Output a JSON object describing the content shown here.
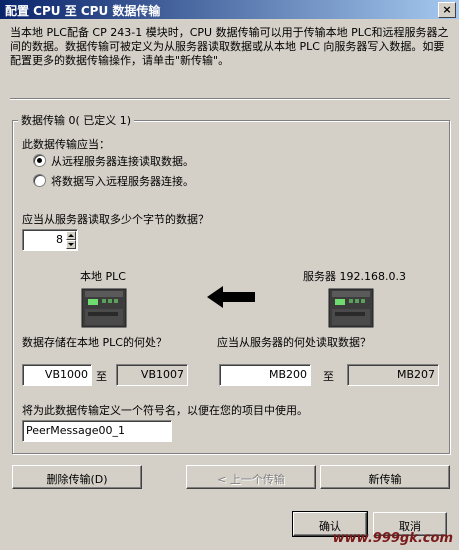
{
  "window": {
    "title": "配置 CPU 至 CPU 数据传输",
    "close_glyph": "×"
  },
  "description": "当本地 PLC配备 CP 243-1 模块时，CPU 数据传输可以用于传输本地 PLC和远程服务器之间的数据。数据传输可被定义为从服务器读取数据或从本地 PLC 向服务器写入数据。如要配置更多的数据传输操作，请单击\"新传输\"。",
  "group_title": "数据传输 0( 已定义 1)",
  "direction": {
    "label": "此数据传输应当：",
    "options": [
      {
        "label": "从远程服务器连接读取数据。",
        "selected": true
      },
      {
        "label": "将数据写入远程服务器连接。",
        "selected": false
      }
    ]
  },
  "bytes": {
    "label": "应当从服务器读取多少个字节的数据？",
    "value": "8"
  },
  "local": {
    "title": "本地 PLC",
    "store_label": "数据存储在本地 PLC的何处？",
    "from": "VB1000",
    "to_word": "至",
    "to": "VB1007"
  },
  "server": {
    "title": "服务器 192.168.0.3",
    "read_label": "应当从服务器的何处读取数据？",
    "from": "MB200",
    "to_word": "至",
    "to": "MB207"
  },
  "symbol": {
    "label": "将为此数据传输定义一个符号名，以便在您的项目中使用。",
    "value": "PeerMessage00_1"
  },
  "buttons": {
    "delete": "删除传输(D)",
    "prev": "< 上一个传输",
    "new": "新传输",
    "ok": "确认",
    "cancel": "取消"
  },
  "watermark": "www.999gk.com"
}
